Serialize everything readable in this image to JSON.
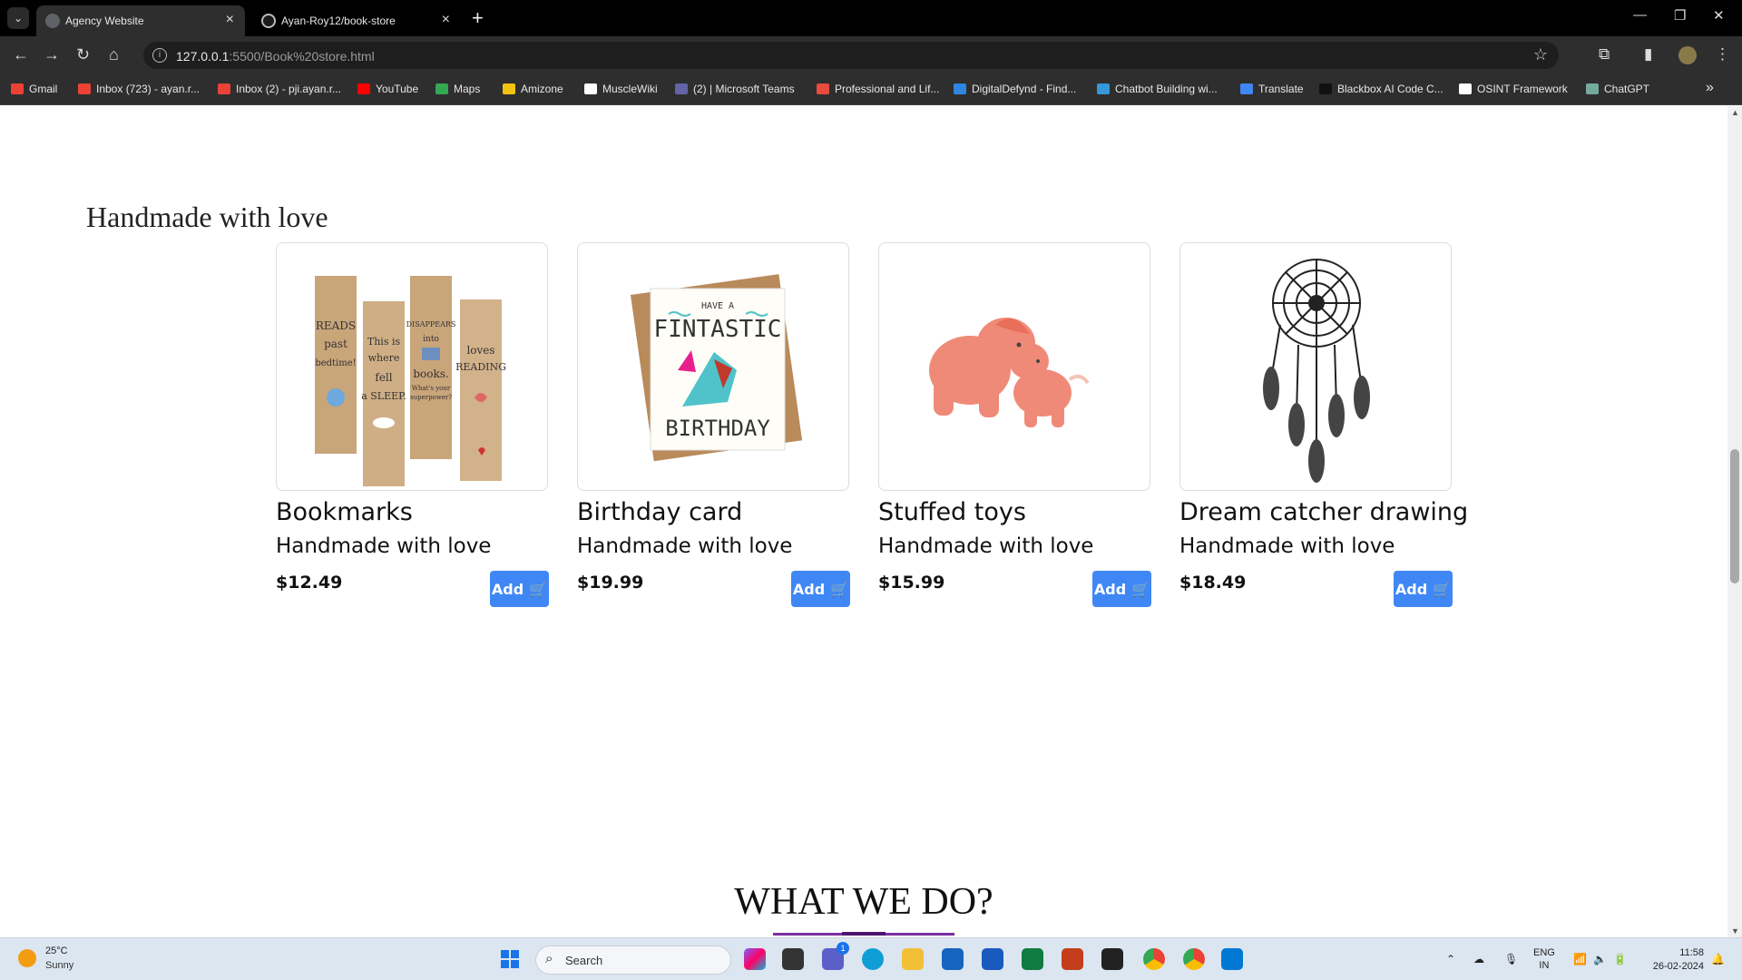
{
  "browser": {
    "tabs": [
      {
        "title": "Agency Website",
        "active": true
      },
      {
        "title": "Ayan-Roy12/book-store",
        "active": false
      }
    ],
    "url_host": "127.0.0.1",
    "url_rest": ":5500/Book%20store.html",
    "bookmarks": [
      {
        "label": "Gmail",
        "icon": "gmail-icon",
        "color": "#ea4335"
      },
      {
        "label": "Inbox (723) - ayan.r...",
        "icon": "gmail-icon",
        "color": "#ea4335"
      },
      {
        "label": "Inbox (2) - pji.ayan.r...",
        "icon": "gmail-icon",
        "color": "#ea4335"
      },
      {
        "label": "YouTube",
        "icon": "youtube-icon",
        "color": "#ff0000"
      },
      {
        "label": "Maps",
        "icon": "maps-icon",
        "color": "#34a853"
      },
      {
        "label": "Amizone",
        "icon": "amizone-icon",
        "color": "#f1c40f"
      },
      {
        "label": "MuscleWiki",
        "icon": "musclewiki-icon",
        "color": "#ffffff"
      },
      {
        "label": "(2) | Microsoft Teams",
        "icon": "teams-icon",
        "color": "#6264a7"
      },
      {
        "label": "Professional and Lif...",
        "icon": "bookmark-site-icon",
        "color": "#e74c3c"
      },
      {
        "label": "DigitalDefynd - Find...",
        "icon": "digitaldefynd-icon",
        "color": "#2e86de"
      },
      {
        "label": "Chatbot Building wi...",
        "icon": "chatbot-icon",
        "color": "#3498db"
      },
      {
        "label": "Translate",
        "icon": "translate-icon",
        "color": "#4285f4"
      },
      {
        "label": "Blackbox AI Code C...",
        "icon": "blackbox-icon",
        "color": "#111111"
      },
      {
        "label": "OSINT Framework",
        "icon": "osint-icon",
        "color": "#ffffff"
      },
      {
        "label": "ChatGPT",
        "icon": "chatgpt-icon",
        "color": "#74aa9c"
      }
    ]
  },
  "page": {
    "section_title": "Handmade with love",
    "products": [
      {
        "name": "Bookmarks",
        "subtitle": "Handmade with love",
        "price": "$12.49",
        "button": "Add"
      },
      {
        "name": "Birthday card",
        "subtitle": "Handmade with love",
        "price": "$19.99",
        "button": "Add"
      },
      {
        "name": "Stuffed toys",
        "subtitle": "Handmade with love",
        "price": "$15.99",
        "button": "Add"
      },
      {
        "name": "Dream catcher drawing",
        "subtitle": "Handmade with love",
        "price": "$18.49",
        "button": "Add"
      }
    ],
    "next_section_title": "WHAT WE DO?",
    "bookmark_images": {
      "b1": [
        "READS",
        "past",
        "bedtime!"
      ],
      "b2": [
        "This is",
        "where",
        "fell",
        "a SLEEP."
      ],
      "b3": [
        "DISAPPEARS",
        "into",
        "books.",
        "What's your",
        "superpower?"
      ],
      "b4": [
        "loves",
        "READING"
      ]
    },
    "card_image_text": {
      "top": "HAVE A",
      "mid": "FINTASTIC",
      "bottom": "BIRTHDAY"
    }
  },
  "taskbar": {
    "weather_temp": "25°C",
    "weather_desc": "Sunny",
    "search_placeholder": "Search",
    "lang_top": "ENG",
    "lang_bottom": "IN",
    "time": "11:58",
    "date": "26-02-2024",
    "teams_badge": "1"
  },
  "colors": {
    "add_button": "#3f87f5",
    "accent_underline": "#7b2fa0"
  }
}
